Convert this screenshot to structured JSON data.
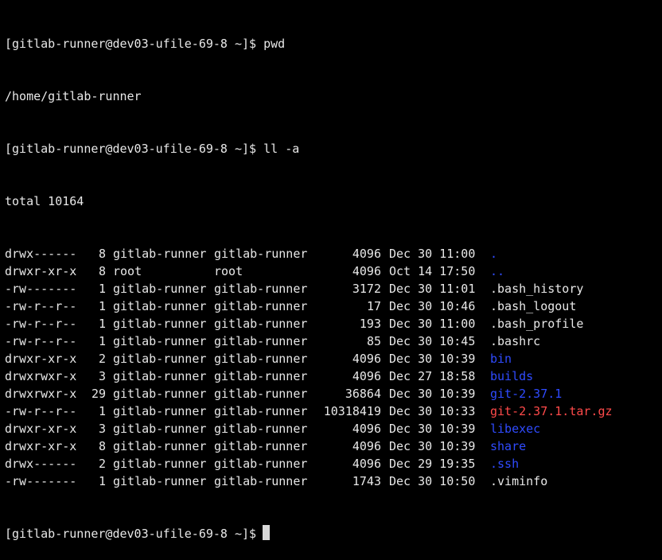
{
  "colors": {
    "background": "#000000",
    "text": "#e8e8e8",
    "directory": "#2f4bff",
    "archive": "#ff4a4a",
    "cursor": "#d8d8d8"
  },
  "session": {
    "prompt": "[gitlab-runner@dev03-ufile-69-8 ~]$",
    "command_1": "pwd",
    "output_1": "/home/gitlab-runner",
    "command_2": "ll -a",
    "total": "total 10164"
  },
  "listing": [
    {
      "perm": "drwx------",
      "links": "8",
      "owner": "gitlab-runner",
      "group": "gitlab-runner",
      "size": "4096",
      "date": "Dec 30 11:00",
      "name": ".",
      "kind": "dir"
    },
    {
      "perm": "drwxr-xr-x",
      "links": "8",
      "owner": "root",
      "group": "root",
      "size": "4096",
      "date": "Oct 14 17:50",
      "name": "..",
      "kind": "dir"
    },
    {
      "perm": "-rw-------",
      "links": "1",
      "owner": "gitlab-runner",
      "group": "gitlab-runner",
      "size": "3172",
      "date": "Dec 30 11:01",
      "name": ".bash_history",
      "kind": "file"
    },
    {
      "perm": "-rw-r--r--",
      "links": "1",
      "owner": "gitlab-runner",
      "group": "gitlab-runner",
      "size": "17",
      "date": "Dec 30 10:46",
      "name": ".bash_logout",
      "kind": "file"
    },
    {
      "perm": "-rw-r--r--",
      "links": "1",
      "owner": "gitlab-runner",
      "group": "gitlab-runner",
      "size": "193",
      "date": "Dec 30 11:00",
      "name": ".bash_profile",
      "kind": "file"
    },
    {
      "perm": "-rw-r--r--",
      "links": "1",
      "owner": "gitlab-runner",
      "group": "gitlab-runner",
      "size": "85",
      "date": "Dec 30 10:45",
      "name": ".bashrc",
      "kind": "file"
    },
    {
      "perm": "drwxr-xr-x",
      "links": "2",
      "owner": "gitlab-runner",
      "group": "gitlab-runner",
      "size": "4096",
      "date": "Dec 30 10:39",
      "name": "bin",
      "kind": "dir"
    },
    {
      "perm": "drwxrwxr-x",
      "links": "3",
      "owner": "gitlab-runner",
      "group": "gitlab-runner",
      "size": "4096",
      "date": "Dec 27 18:58",
      "name": "builds",
      "kind": "dir"
    },
    {
      "perm": "drwxrwxr-x",
      "links": "29",
      "owner": "gitlab-runner",
      "group": "gitlab-runner",
      "size": "36864",
      "date": "Dec 30 10:39",
      "name": "git-2.37.1",
      "kind": "dir"
    },
    {
      "perm": "-rw-r--r--",
      "links": "1",
      "owner": "gitlab-runner",
      "group": "gitlab-runner",
      "size": "10318419",
      "date": "Dec 30 10:33",
      "name": "git-2.37.1.tar.gz",
      "kind": "archive"
    },
    {
      "perm": "drwxr-xr-x",
      "links": "3",
      "owner": "gitlab-runner",
      "group": "gitlab-runner",
      "size": "4096",
      "date": "Dec 30 10:39",
      "name": "libexec",
      "kind": "dir"
    },
    {
      "perm": "drwxr-xr-x",
      "links": "8",
      "owner": "gitlab-runner",
      "group": "gitlab-runner",
      "size": "4096",
      "date": "Dec 30 10:39",
      "name": "share",
      "kind": "dir"
    },
    {
      "perm": "drwx------",
      "links": "2",
      "owner": "gitlab-runner",
      "group": "gitlab-runner",
      "size": "4096",
      "date": "Dec 29 19:35",
      "name": ".ssh",
      "kind": "dir"
    },
    {
      "perm": "-rw-------",
      "links": "1",
      "owner": "gitlab-runner",
      "group": "gitlab-runner",
      "size": "1743",
      "date": "Dec 30 10:50",
      "name": ".viminfo",
      "kind": "file"
    }
  ]
}
